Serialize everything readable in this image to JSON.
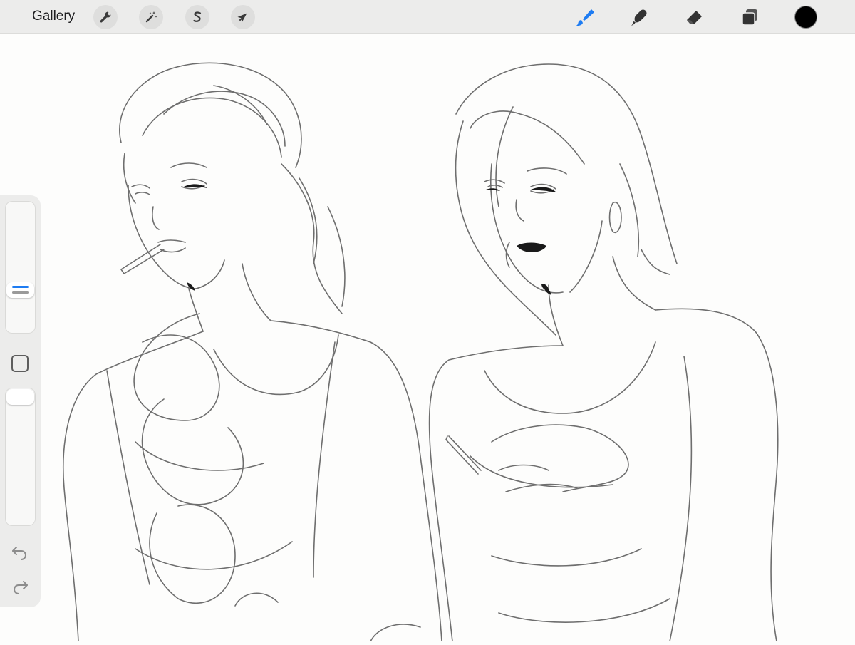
{
  "app": {
    "gallery_label": "Gallery",
    "accent_color": "#1e7cf2"
  },
  "toolbar_left": [
    {
      "name": "actions",
      "icon": "wrench-icon"
    },
    {
      "name": "adjustments",
      "icon": "magic-wand-icon"
    },
    {
      "name": "selection",
      "icon": "selection-s-icon"
    },
    {
      "name": "transform",
      "icon": "arrow-cursor-icon"
    }
  ],
  "toolbar_right": [
    {
      "name": "brush",
      "icon": "brush-icon",
      "active": true
    },
    {
      "name": "smudge",
      "icon": "smudge-icon",
      "active": false
    },
    {
      "name": "eraser",
      "icon": "eraser-icon",
      "active": false
    },
    {
      "name": "layers",
      "icon": "layers-icon",
      "active": false
    }
  ],
  "current_color": "#000000",
  "sidebar": {
    "brush_size_level": 0.3,
    "opacity_level": 1.0,
    "undo_icon": "undo-icon",
    "redo_icon": "redo-icon",
    "modify_icon": "square-icon"
  },
  "canvas": {
    "content": "pencil-sketch-artwork"
  }
}
